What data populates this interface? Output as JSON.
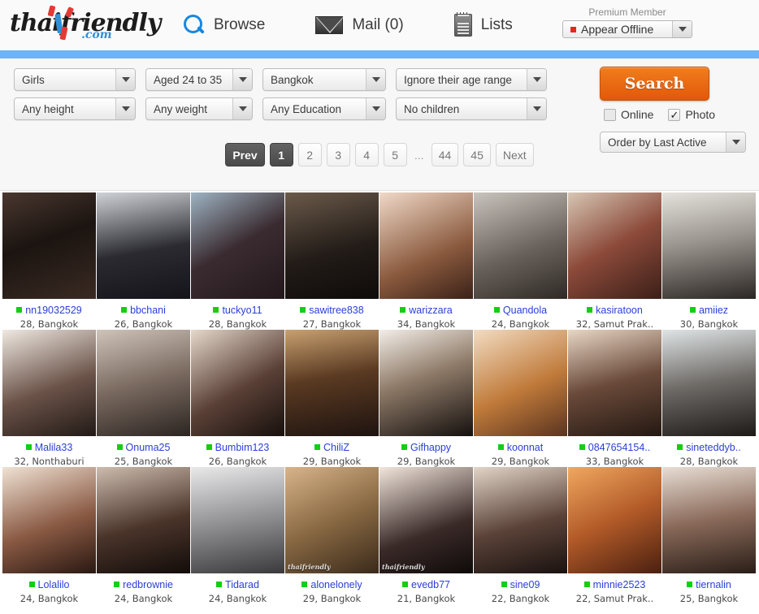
{
  "header": {
    "logo": {
      "main": "thaifriendly",
      "dot_com": ".com"
    },
    "nav": [
      {
        "label": "Browse",
        "icon": "search-icon"
      },
      {
        "label": "Mail (0)",
        "icon": "mail-icon"
      },
      {
        "label": "Lists",
        "icon": "lists-icon"
      }
    ],
    "premium_label": "Premium Member",
    "status": {
      "value": "Appear Offline",
      "dot_color": "#e12a1c"
    }
  },
  "search_panel": {
    "filters_row1": [
      {
        "name": "gender",
        "value": "Girls",
        "width": "w1"
      },
      {
        "name": "age-range",
        "value": "Aged 24 to 35",
        "width": "w2"
      },
      {
        "name": "location",
        "value": "Bangkok",
        "width": "w3"
      },
      {
        "name": "their-age-range",
        "value": "Ignore their age range",
        "width": "w4"
      }
    ],
    "filters_row2": [
      {
        "name": "height",
        "value": "Any height",
        "width": "w1"
      },
      {
        "name": "weight",
        "value": "Any weight",
        "width": "w2"
      },
      {
        "name": "education",
        "value": "Any Education",
        "width": "w3"
      },
      {
        "name": "children",
        "value": "No children",
        "width": "w4"
      }
    ],
    "search_button": "Search",
    "checkboxes": [
      {
        "label": "Online",
        "checked": false
      },
      {
        "label": "Photo",
        "checked": true,
        "mark": "✓"
      }
    ],
    "order_by": "Order by Last Active",
    "accent_color": "#e2580a"
  },
  "pagination": [
    {
      "label": "Prev",
      "state": "dark"
    },
    {
      "label": "1",
      "state": "dark"
    },
    {
      "label": "2",
      "state": "normal"
    },
    {
      "label": "3",
      "state": "normal"
    },
    {
      "label": "4",
      "state": "normal"
    },
    {
      "label": "5",
      "state": "normal"
    },
    {
      "label": "...",
      "state": "ellipsis"
    },
    {
      "label": "44",
      "state": "normal"
    },
    {
      "label": "45",
      "state": "normal"
    },
    {
      "label": "Next",
      "state": "normal"
    }
  ],
  "grid": {
    "rows": [
      [
        {
          "username": "nn19032529",
          "sub": "28, Bangkok",
          "online": true,
          "watermark": "",
          "bg": "linear-gradient(160deg,#4a3730,#1b1410 45%,#3a2a23)"
        },
        {
          "username": "bbchani",
          "sub": "26, Bangkok",
          "online": true,
          "watermark": "",
          "bg": "linear-gradient(170deg,#cfd2d6,#2a2a30 55%,#14141a)"
        },
        {
          "username": "tuckyo11",
          "sub": "28, Bangkok",
          "online": true,
          "watermark": "",
          "bg": "linear-gradient(150deg,#9fb4c4,#3a2b30 50%,#23181c)"
        },
        {
          "username": "sawitree838",
          "sub": "27, Bangkok",
          "online": true,
          "watermark": "",
          "bg": "linear-gradient(165deg,#6b5a4a,#231c18 55%,#0e0b09)"
        },
        {
          "username": "warizzara",
          "sub": "34, Bangkok",
          "online": true,
          "watermark": "",
          "bg": "linear-gradient(155deg,#f0d9c8,#8a5a3e 60%,#3a2118)"
        },
        {
          "username": "Quandola",
          "sub": "24, Bangkok",
          "online": true,
          "watermark": "",
          "bg": "linear-gradient(160deg,#c9c4bd,#6a625c 55%,#2f2a26)"
        },
        {
          "username": "kasiratoon",
          "sub": "32, Samut Prak..",
          "online": true,
          "watermark": "",
          "bg": "linear-gradient(150deg,#d7c6b4,#8c4a3a 50%,#3b1f18)"
        },
        {
          "username": "amiiez",
          "sub": "30, Bangkok",
          "online": true,
          "watermark": "",
          "bg": "linear-gradient(170deg,#e5e2dd,#9a958e 45%,#2b2724)"
        }
      ],
      [
        {
          "username": "Malila33",
          "sub": "32, Nonthaburi",
          "online": true,
          "watermark": "",
          "bg": "linear-gradient(160deg,#efe9e2,#6a5248 55%,#221a16)"
        },
        {
          "username": "Onuma25",
          "sub": "25, Bangkok",
          "online": true,
          "watermark": "",
          "bg": "linear-gradient(165deg,#cfc4ba,#7a6a60 50%,#2c2522)"
        },
        {
          "username": "Bumbim123",
          "sub": "26, Bangkok",
          "online": true,
          "watermark": "",
          "bg": "linear-gradient(150deg,#e6d8cc,#5a4036 55%,#17100d)"
        },
        {
          "username": "ChiliZ",
          "sub": "29, Bangkok",
          "online": true,
          "watermark": "",
          "bg": "linear-gradient(170deg,#c8a070,#5a3a22 45%,#1e1310)"
        },
        {
          "username": "Gifhappy",
          "sub": "29, Bangkok",
          "online": true,
          "watermark": "",
          "bg": "linear-gradient(160deg,#f3eee8,#8e7a68 45%,#15100e)"
        },
        {
          "username": "koonnat",
          "sub": "29, Bangkok",
          "online": true,
          "watermark": "",
          "bg": "linear-gradient(155deg,#f2dcc2,#c07a3a 55%,#5a3420)"
        },
        {
          "username": "0847654154..",
          "sub": "33, Bangkok",
          "online": true,
          "watermark": "",
          "bg": "linear-gradient(165deg,#e8d6c4,#6a4a3a 50%,#241812)"
        },
        {
          "username": "sineteddyb..",
          "sub": "28, Bangkok",
          "online": true,
          "watermark": "",
          "bg": "linear-gradient(170deg,#dfe4e6,#6e6a66 50%,#1d1a18)"
        }
      ],
      [
        {
          "username": "Lolalilo",
          "sub": "24, Bangkok",
          "online": true,
          "watermark": "",
          "bg": "linear-gradient(160deg,#f0e2d4,#8a5a44 55%,#2a1812)"
        },
        {
          "username": "redbrownie",
          "sub": "24, Bangkok",
          "online": true,
          "watermark": "",
          "bg": "linear-gradient(165deg,#cdbcae,#4a342a 55%,#120c09)"
        },
        {
          "username": "Tidarad",
          "sub": "24, Bangkok",
          "online": true,
          "watermark": "",
          "bg": "linear-gradient(170deg,#e9e9ea,#9a9a9c 45%,#3a3a3c)"
        },
        {
          "username": "alonelonely",
          "sub": "29, Bangkok",
          "online": true,
          "watermark": "thaifriendly",
          "bg": "linear-gradient(155deg,#d8b48a,#8a6a44 50%,#3a2a1a)"
        },
        {
          "username": "evedb77",
          "sub": "21, Bangkok",
          "online": true,
          "watermark": "thaifriendly",
          "bg": "linear-gradient(160deg,#f2e6dc,#3a2a28 60%,#0e0a09)"
        },
        {
          "username": "sine09",
          "sub": "22, Bangkok",
          "online": true,
          "watermark": "",
          "bg": "linear-gradient(165deg,#e2d4c8,#5a4238 55%,#1a1210)"
        },
        {
          "username": "minnie2523",
          "sub": "22, Samut Prak..",
          "online": true,
          "watermark": "",
          "bg": "linear-gradient(155deg,#f0a860,#b25a28 50%,#4a2010)"
        },
        {
          "username": "tiernalin",
          "sub": "25, Bangkok",
          "online": true,
          "watermark": "",
          "bg": "linear-gradient(170deg,#e8ddd4,#8a6a5a 50%,#2a1e18)"
        }
      ]
    ]
  }
}
